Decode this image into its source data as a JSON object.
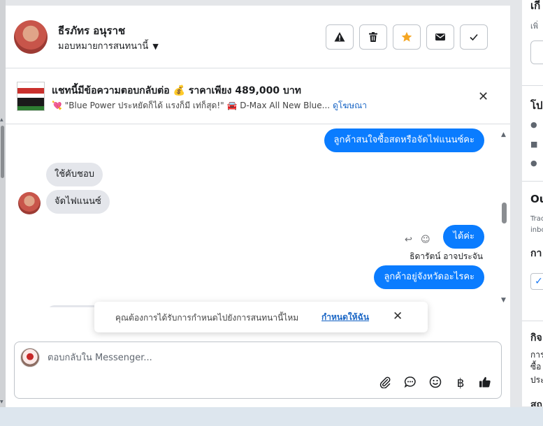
{
  "header": {
    "contact_name": "ธีรภัทร อนุราช",
    "assign_label": "มอบหมายการสนทนานี้",
    "buttons": [
      "spam-icon",
      "trash-icon",
      "star-icon",
      "envelope-icon",
      "check-icon"
    ],
    "star_color": "#f5a623"
  },
  "ad": {
    "title": "แชทนี้มีข้อความตอบกลับต่อ 💰 ราคาเพียง 489,000 บาท",
    "subtitle": "💘 \"Blue Power ประหยัดก็ได้ แรงก็มี เท่ก็สุด!\" 🚘 D-Max All New Blue...",
    "link": "ดูโฆษณา"
  },
  "messages": [
    {
      "dir": "out",
      "text": "ลูกค้าสนใจซื้อสดหรือจัดไฟแนนซ์คะ"
    },
    {
      "dir": "in",
      "text": "ใช้คับชอบ"
    },
    {
      "dir": "in",
      "text": "จัดไฟแนนซ์"
    },
    {
      "dir": "out",
      "text": "ได้ค่ะ"
    },
    {
      "dir": "out",
      "sender": "ธิดารัตน์ อาจประจัน",
      "text": "ลูกค้าอยู่จังหวัดอะไรคะ"
    }
  ],
  "toast": {
    "text": "คุณต้องการได้รับการกำหนดไปยังการสนทนานี้ไหม",
    "link": "กำหนดให้ฉัน"
  },
  "composer": {
    "placeholder": "ตอบกลับใน Messenger...",
    "icons": [
      "attach-icon",
      "saved-reply-icon",
      "emoji-icon",
      "baht-icon",
      "thumbs-up-icon"
    ],
    "baht_symbol": "฿"
  },
  "right_panel": {
    "texts": [
      "เกี",
      "เพิ่",
      "โป",
      "Ou",
      "Trac",
      "inbo",
      "กา",
      "กิจ",
      "การ",
      "ซื้อ",
      "ประ",
      "สถ"
    ]
  },
  "colors": {
    "outgoing_bubble": "#0a7cff",
    "incoming_bubble": "#e4e6eb",
    "link": "#1a66c5"
  }
}
